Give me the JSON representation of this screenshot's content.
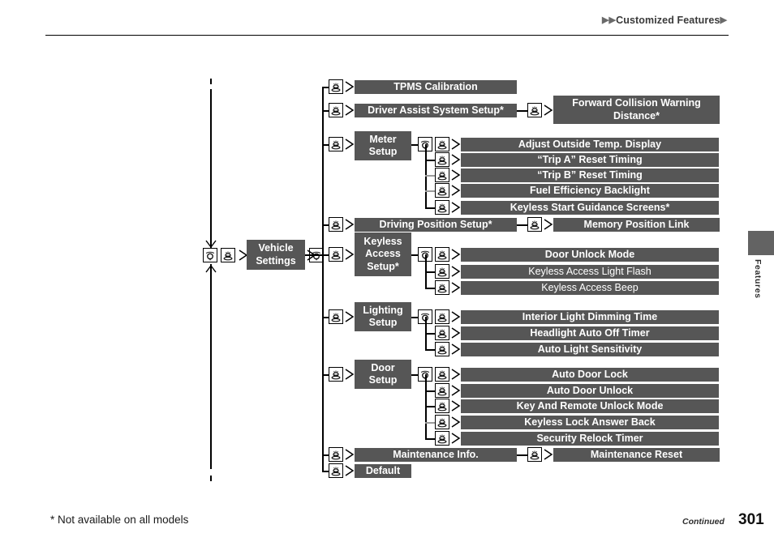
{
  "header": {
    "breadcrumb": "Customized Features",
    "tri_left": "▶▶",
    "tri_right": "▶"
  },
  "side_tab": {
    "label": "Features"
  },
  "footer": {
    "footnote": "* Not available on all models",
    "continued": "Continued",
    "page_number": "301"
  },
  "colors": {
    "box_fill": "#565656",
    "box_text": "#ffffff",
    "line": "#000000",
    "line_gray": "#9a9a9a",
    "tab_fill": "#636363"
  },
  "icons": {
    "dial": "rotate-dial-icon",
    "press": "press-knob-icon"
  },
  "diagram": {
    "root": {
      "label": "Vehicle\nSettings"
    },
    "level1": [
      {
        "label": "TPMS Calibration"
      },
      {
        "label": "Driver Assist System Setup*"
      },
      {
        "label": "Meter\nSetup"
      },
      {
        "label": "Driving Position Setup*"
      },
      {
        "label": "Keyless\nAccess\nSetup*"
      },
      {
        "label": "Lighting\nSetup"
      },
      {
        "label": "Door\nSetup"
      },
      {
        "label": "Maintenance Info."
      },
      {
        "label": "Default"
      }
    ],
    "level2": {
      "driver_assist": [
        {
          "label": "Forward Collision Warning\nDistance*",
          "weight": "bold"
        }
      ],
      "meter_setup": [
        {
          "label": "Adjust Outside Temp. Display",
          "weight": "bold"
        },
        {
          "label": "“Trip A” Reset Timing",
          "weight": "bold"
        },
        {
          "label": "“Trip B” Reset Timing",
          "weight": "bold"
        },
        {
          "label": "Fuel Efficiency Backlight",
          "weight": "bold"
        },
        {
          "label": "Keyless Start Guidance Screens*",
          "weight": "bold"
        }
      ],
      "driving_position": [
        {
          "label": "Memory Position Link",
          "weight": "bold"
        }
      ],
      "keyless_access": [
        {
          "label": "Door Unlock Mode",
          "weight": "bold"
        },
        {
          "label": "Keyless Access Light Flash",
          "weight": "normal"
        },
        {
          "label": "Keyless Access Beep",
          "weight": "normal"
        }
      ],
      "lighting_setup": [
        {
          "label": "Interior Light Dimming Time",
          "weight": "bold"
        },
        {
          "label": "Headlight Auto Off Timer",
          "weight": "bold"
        },
        {
          "label": "Auto Light Sensitivity",
          "weight": "bold"
        }
      ],
      "door_setup": [
        {
          "label": "Auto Door Lock",
          "weight": "bold"
        },
        {
          "label": "Auto Door Unlock",
          "weight": "bold"
        },
        {
          "label": "Key And Remote Unlock Mode",
          "weight": "bold"
        },
        {
          "label": "Keyless Lock Answer Back",
          "weight": "bold"
        },
        {
          "label": "Security Relock Timer",
          "weight": "bold"
        }
      ],
      "maintenance": [
        {
          "label": "Maintenance Reset",
          "weight": "bold"
        }
      ]
    }
  }
}
